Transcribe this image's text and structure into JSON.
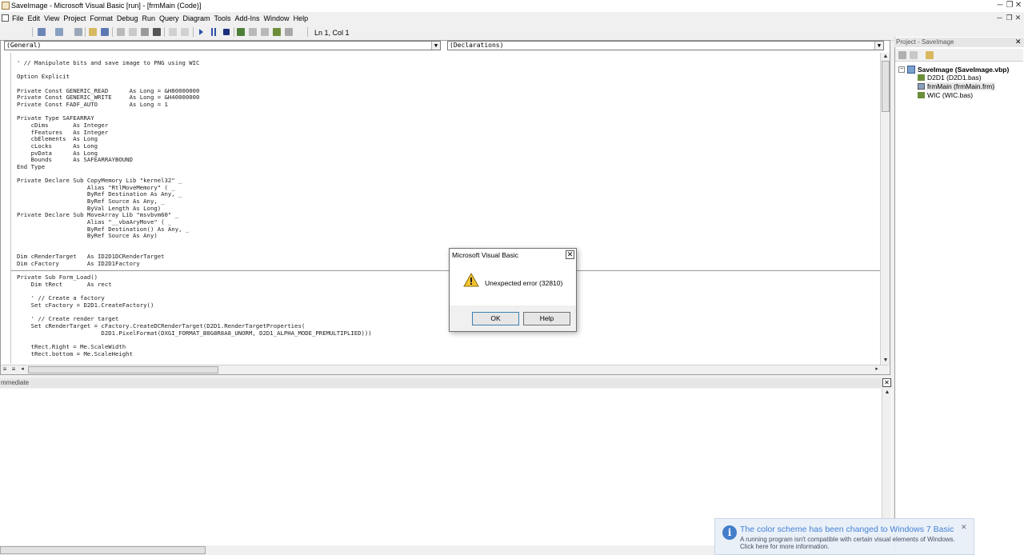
{
  "window": {
    "title": "SaveImage - Microsoft Visual Basic [run] - [frmMain (Code)]",
    "minimize": "─",
    "restore": "❐",
    "close": "✕"
  },
  "menu": {
    "items": [
      "File",
      "Edit",
      "View",
      "Project",
      "Format",
      "Debug",
      "Run",
      "Query",
      "Diagram",
      "Tools",
      "Add-Ins",
      "Window",
      "Help"
    ]
  },
  "toolbar": {
    "position": "Ln 1, Col 1"
  },
  "code": {
    "object_combo": "(General)",
    "proc_combo": "(Declarations)",
    "lines": [
      "' // Manipulate bits and save image to PNG using WIC",
      "",
      "Option Explicit",
      "",
      "Private Const GENERIC_READ      As Long = &H80000000",
      "Private Const GENERIC_WRITE     As Long = &H40000000",
      "Private Const FADF_AUTO         As Long = 1",
      "",
      "Private Type SAFEARRAY",
      "    cDims       As Integer",
      "    fFeatures   As Integer",
      "    cbElements  As Long",
      "    cLocks      As Long",
      "    pvData      As Long",
      "    Bounds      As SAFEARRAYBOUND",
      "End Type",
      "",
      "Private Declare Sub CopyMemory Lib \"kernel32\" _",
      "                    Alias \"RtlMoveMemory\" ( _",
      "                    ByRef Destination As Any, _",
      "                    ByRef Source As Any, _",
      "                    ByVal Length As Long)",
      "Private Declare Sub MoveArray Lib \"msvbvm60\" _",
      "                    Alias \"__vbaAryMove\" ( _",
      "                    ByRef Destination() As Any, _",
      "                    ByRef Source As Any)",
      "",
      "",
      "Dim cRenderTarget   As ID2D1DCRenderTarget",
      "Dim cFactory        As ID2D1Factory",
      "",
      "Private Sub Form_Load()",
      "    Dim tRect       As rect",
      "",
      "    ' // Create a factory",
      "    Set cFactory = D2D1.CreateFactory()",
      "",
      "    ' // Create render target",
      "    Set cRenderTarget = cFactory.CreateDCRenderTarget(D2D1.RenderTargetProperties(",
      "                        D2D1.PixelFormat(DXGI_FORMAT_B8G8R8A8_UNORM, D2D1_ALPHA_MODE_PREMULTIPLIED)))",
      "",
      "    tRect.Right = Me.ScaleWidth",
      "    tRect.bottom = Me.ScaleHeight"
    ]
  },
  "project": {
    "title": "Project - SaveImage",
    "root": "SaveImage (SaveImage.vbp)",
    "items": [
      "D2D1 (D2D1.bas)",
      "frmMain (frmMain.frm)",
      "WIC (WIC.bas)"
    ]
  },
  "immediate": {
    "title": "mmediate"
  },
  "dialog": {
    "title": "Microsoft Visual Basic",
    "message": "Unexpected error (32810)",
    "ok": "OK",
    "help": "Help",
    "close": "✕"
  },
  "toast": {
    "title": "The color scheme has been changed to Windows 7 Basic",
    "line1": "A running program isn't compatible with certain visual elements of Windows.",
    "line2": "Click here for more information.",
    "close": "✕"
  },
  "colors": {
    "accent": "#3a78c8",
    "warning": "#f2c22e"
  }
}
